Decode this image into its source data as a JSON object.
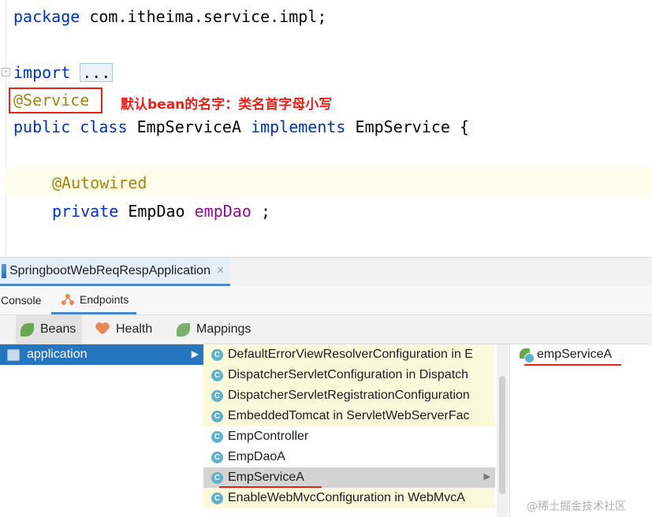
{
  "editor": {
    "line1": {
      "kw": "package",
      "rest": " com.itheima.service.impl;"
    },
    "line2": {
      "kw": "import",
      "fold": "..."
    },
    "line3": {
      "annotation": "@Service"
    },
    "note": "默认bean的名字：类名首字母小写",
    "line4": {
      "kw1": "public",
      "kw2": "class",
      "name": "EmpServiceA",
      "kw3": "implements",
      "iface": "EmpService",
      "brace": "{"
    },
    "line5": {
      "annotation": "@Autowired"
    },
    "line6": {
      "kw": "private",
      "type": "EmpDao",
      "field": "empDao",
      "semi": ";"
    }
  },
  "tool_window": {
    "run_tab": "SpringbootWebReqRespApplication",
    "close_glyph": "×",
    "sub_tabs": {
      "console": "Console",
      "endpoints": "Endpoints"
    },
    "bean_tabs": {
      "beans": "Beans",
      "health": "Health",
      "mappings": "Mappings"
    }
  },
  "left_panel": {
    "item": "application",
    "arrow": "▶"
  },
  "middle_panel": {
    "class_glyph": "C",
    "rows": [
      {
        "label": "DefaultErrorViewResolverConfiguration in E",
        "style": "yellow"
      },
      {
        "label": "DispatcherServletConfiguration in Dispatch",
        "style": "yellow"
      },
      {
        "label": "DispatcherServletRegistrationConfiguration",
        "style": "yellow"
      },
      {
        "label": "EmbeddedTomcat in ServletWebServerFac",
        "style": "yellow"
      },
      {
        "label": "EmpController",
        "style": "plain"
      },
      {
        "label": "EmpDaoA",
        "style": "plain"
      },
      {
        "label": "EmpServiceA",
        "style": "selected"
      },
      {
        "label": "EnableWebMvcConfiguration in WebMvcA",
        "style": "yellow"
      }
    ],
    "row_arrow": "▶"
  },
  "right_panel": {
    "bean": "empServiceA"
  },
  "watermark": "@稀土掘金技术社区",
  "colors": {
    "keyword": "#0033b3",
    "annotation": "#9e880d",
    "field": "#871094",
    "note_red": "#e8211a",
    "selection": "#2675bf"
  }
}
